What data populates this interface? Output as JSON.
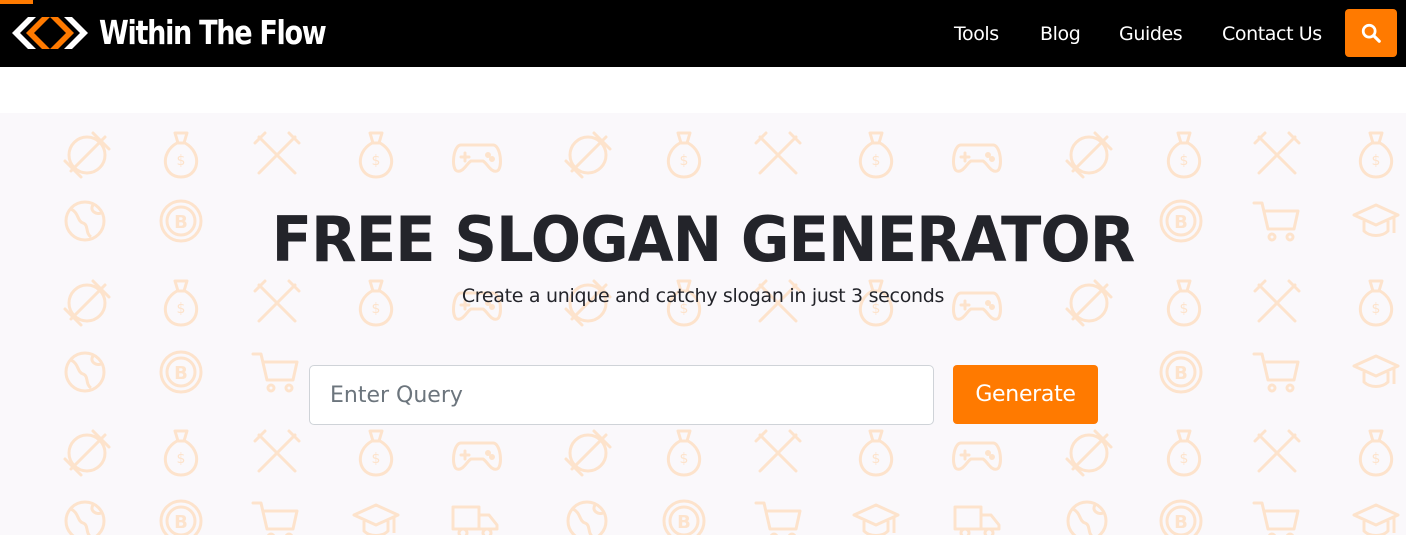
{
  "brand": {
    "name": "Within The Flow",
    "accent_color": "#ff7a00",
    "header_bg": "#000000"
  },
  "nav": {
    "items": [
      {
        "label": "Tools"
      },
      {
        "label": "Blog"
      },
      {
        "label": "Guides"
      },
      {
        "label": "Contact Us"
      }
    ],
    "search_icon": "search-icon"
  },
  "hero": {
    "title": "FREE SLOGAN GENERATOR",
    "subtitle": "Create a unique and catchy slogan in just 3 seconds",
    "background_pattern_icons": [
      "dumbbell-icon",
      "money-bag-icon",
      "fork-knife-icon",
      "gamepad-icon",
      "globe-icon",
      "bitcoin-icon",
      "shopping-cart-icon",
      "delivery-truck-icon",
      "graduation-cap-icon"
    ],
    "pattern_color": "#fde3cc",
    "background_color": "#faf8fb"
  },
  "form": {
    "input_value": "",
    "input_placeholder": "Enter Query",
    "button_label": "Generate"
  }
}
